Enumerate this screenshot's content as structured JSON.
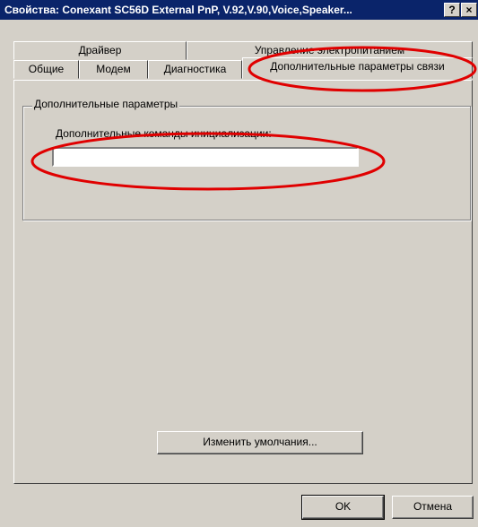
{
  "window": {
    "title": "Свойства: Conexant SC56D External PnP, V.92,V.90,Voice,Speaker...",
    "help_button": "?",
    "close_button": "×"
  },
  "tabs_back": [
    {
      "label": "Драйвер"
    },
    {
      "label": "Управление электропитанием"
    }
  ],
  "tabs_front": [
    {
      "label": "Общие"
    },
    {
      "label": "Модем"
    },
    {
      "label": "Диагностика"
    },
    {
      "label": "Дополнительные параметры связи"
    }
  ],
  "panel": {
    "group_label": "Дополнительные параметры",
    "init_label": "Дополнительные команды инициализации:",
    "init_value": "",
    "defaults_button": "Изменить умолчания..."
  },
  "footer": {
    "ok": "OK",
    "cancel": "Отмена"
  },
  "colors": {
    "titlebar": "#0a246a",
    "face": "#d4d0c8",
    "annotation": "#e00000"
  }
}
